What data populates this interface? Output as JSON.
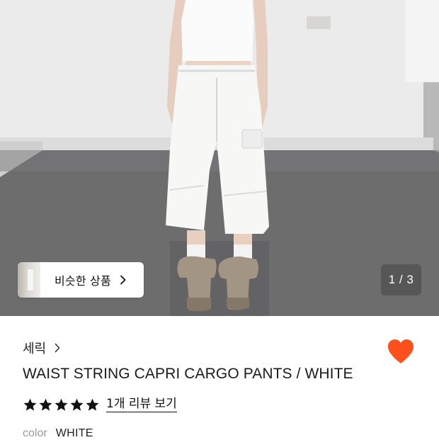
{
  "gallery": {
    "similar_label": "비슷한 상품",
    "page_indicator": "1 / 3"
  },
  "product": {
    "brand": "세릭",
    "title": "WAIST STRING CAPRI CARGO PANTS / WHITE",
    "rating": 5,
    "rating_max": 5,
    "review_link": "1개 리뷰 보기",
    "option_key": "color",
    "option_value": "WHITE",
    "favorited": true
  },
  "colors": {
    "heart": "#ff4f1a",
    "star": "#111111"
  },
  "icons": {
    "brand_chevron": "chevron-right-icon",
    "similar_chevron": "chevron-right-icon",
    "favorite": "heart-icon",
    "rating": "star-icon"
  }
}
